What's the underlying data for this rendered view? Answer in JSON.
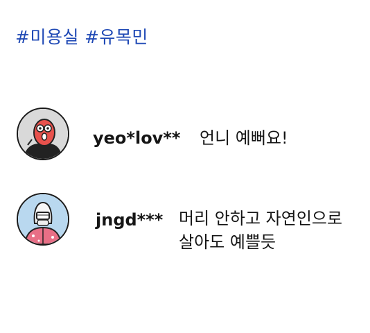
{
  "hashtags": [
    "#미용실",
    "#유목민"
  ],
  "comments": [
    {
      "avatar": "red-character-avatar",
      "username": "yeo*lov**",
      "text": "언니 예뻐요!"
    },
    {
      "avatar": "masked-character-avatar",
      "username": "jngd***",
      "text_lines": [
        "머리 안하고 자연인으로",
        "살아도 예쁠듯"
      ]
    }
  ],
  "colors": {
    "hashtag": "#1f49b5",
    "text": "#151515",
    "background": "#ffffff"
  }
}
